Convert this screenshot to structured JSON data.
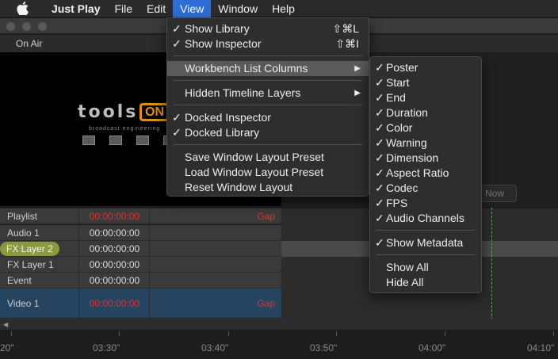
{
  "menubar": {
    "app_name": "Just Play",
    "items": [
      "File",
      "Edit",
      "View",
      "Window",
      "Help"
    ],
    "active": "View"
  },
  "window": {
    "on_air_label": "On Air",
    "now_button": "Now"
  },
  "preview": {
    "logo_text": "tools",
    "logo_on": "ON",
    "logo_tagline": "broadcast engineering"
  },
  "tracks": [
    {
      "name": "Playlist",
      "timecode": "00:00:00:00",
      "timecode_red": true,
      "gap": "Gap"
    },
    {
      "name": "Audio 1",
      "timecode": "00:00:00:00",
      "timecode_red": false,
      "gap": ""
    },
    {
      "name": "FX Layer 2",
      "timecode": "00:00:00:00",
      "timecode_red": false,
      "gap": "",
      "selected": true
    },
    {
      "name": "FX Layer 1",
      "timecode": "00:00:00:00",
      "timecode_red": false,
      "gap": ""
    },
    {
      "name": "Event",
      "timecode": "00:00:00:00",
      "timecode_red": false,
      "gap": ""
    },
    {
      "name": "Video 1",
      "timecode": "00:00:00:00",
      "timecode_red": true,
      "gap": "Gap"
    }
  ],
  "ruler": {
    "labels": [
      "20\"",
      "03:30\"",
      "03:40\"",
      "03:50\"",
      "04:00\"",
      "04:10\""
    ]
  },
  "view_menu": {
    "items": [
      {
        "label": "Show Library",
        "checked": true,
        "shortcut": "⇧⌘L"
      },
      {
        "label": "Show Inspector",
        "checked": true,
        "shortcut": "⇧⌘I"
      },
      {
        "label": "Workbench List Columns",
        "checked": false,
        "submenu": true,
        "highlighted": true
      },
      {
        "label": "Hidden Timeline Layers",
        "checked": false,
        "submenu": true
      },
      {
        "label": "Docked Inspector",
        "checked": true
      },
      {
        "label": "Docked Library",
        "checked": true
      },
      {
        "label": "Save Window Layout Preset",
        "checked": false
      },
      {
        "label": "Load Window Layout Preset",
        "checked": false
      },
      {
        "label": "Reset Window Layout",
        "checked": false
      }
    ]
  },
  "submenu": {
    "items": [
      {
        "label": "Poster",
        "checked": true
      },
      {
        "label": "Start",
        "checked": true
      },
      {
        "label": "End",
        "checked": true
      },
      {
        "label": "Duration",
        "checked": true
      },
      {
        "label": "Color",
        "checked": true
      },
      {
        "label": "Warning",
        "checked": true
      },
      {
        "label": "Dimension",
        "checked": true
      },
      {
        "label": "Aspect Ratio",
        "checked": true
      },
      {
        "label": "Codec",
        "checked": true
      },
      {
        "label": "FPS",
        "checked": true
      },
      {
        "label": "Audio Channels",
        "checked": true
      },
      {
        "label": "Show Metadata",
        "checked": true
      },
      {
        "label": "Show All",
        "checked": false
      },
      {
        "label": "Hide All",
        "checked": false
      }
    ]
  },
  "colors": {
    "menu_highlight": "#2d6fd6",
    "timecode_red": "#e03434",
    "selected_track": "#8a9a3c",
    "video_track": "#24445f",
    "logo_orange": "#e88b0e"
  }
}
